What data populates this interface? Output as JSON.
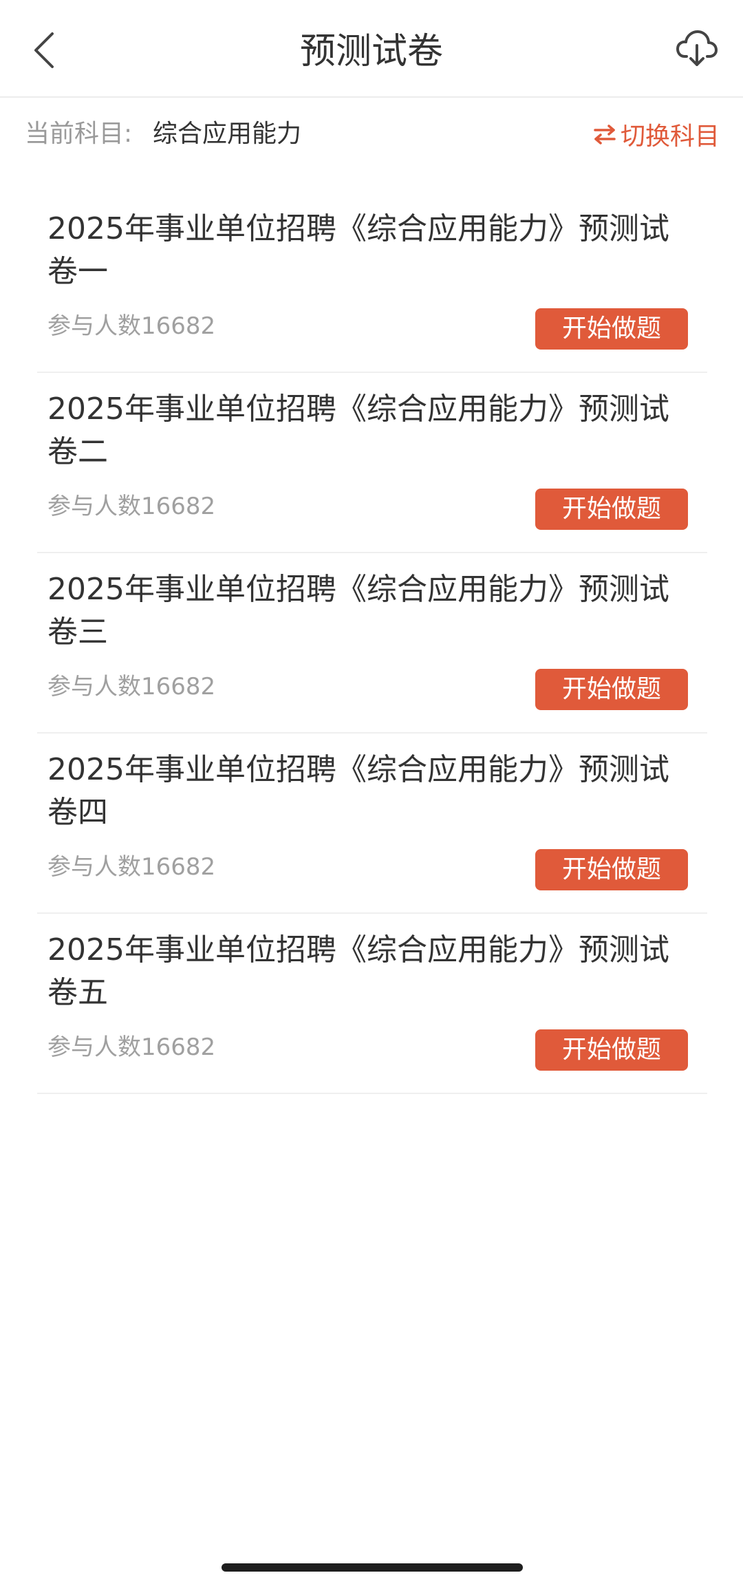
{
  "header": {
    "title": "预测试卷",
    "back_icon": "chevron-left-icon",
    "download_icon": "cloud-download-icon"
  },
  "subject": {
    "label": "当前科目:",
    "current": "综合应用能力",
    "switch_label": "切换科目",
    "switch_icon": "swap-arrows-icon",
    "accent_color": "#e05a3a"
  },
  "papers": [
    {
      "title": "2025年事业单位招聘《综合应用能力》预测试卷一",
      "participants": "参与人数16682",
      "action": "开始做题"
    },
    {
      "title": "2025年事业单位招聘《综合应用能力》预测试卷二",
      "participants": "参与人数16682",
      "action": "开始做题"
    },
    {
      "title": "2025年事业单位招聘《综合应用能力》预测试卷三",
      "participants": "参与人数16682",
      "action": "开始做题"
    },
    {
      "title": "2025年事业单位招聘《综合应用能力》预测试卷四",
      "participants": "参与人数16682",
      "action": "开始做题"
    },
    {
      "title": "2025年事业单位招聘《综合应用能力》预测试卷五",
      "participants": "参与人数16682",
      "action": "开始做题"
    }
  ]
}
